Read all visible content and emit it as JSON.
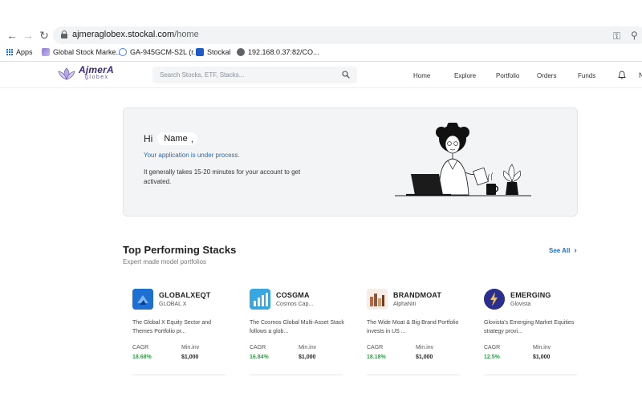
{
  "browser": {
    "url_host": "ajmeraglobex.stockal.com",
    "url_path": "/home",
    "bookmarks": [
      {
        "label": "Apps"
      },
      {
        "label": "Global Stock Marke..."
      },
      {
        "label": "GA-945GCM-S2L (r..."
      },
      {
        "label": "Stockal"
      },
      {
        "label": "192.168.0.37:82/CO..."
      }
    ]
  },
  "header": {
    "logo_name": "AjmerA",
    "logo_sub": "globex",
    "search_placeholder": "Search Stocks, ETF, Stacks...",
    "nav": [
      {
        "label": "Home"
      },
      {
        "label": "Explore"
      },
      {
        "label": "Portfolio"
      },
      {
        "label": "Orders"
      },
      {
        "label": "Funds"
      }
    ],
    "cut_text": "N"
  },
  "welcome": {
    "greeting": "Hi",
    "name": "Name",
    "comma": ",",
    "status": "Your application is under process.",
    "info": "It generally takes 15-20 minutes for your account to get activated."
  },
  "stacks": {
    "title": "Top Performing Stacks",
    "subtitle": "Expert made model portfolios",
    "see_all": "See All",
    "cagr_label": "CAGR",
    "min_label": "Min.inv",
    "items": [
      {
        "ticker": "GLOBALXEQT",
        "provider": "GLOBAL X",
        "desc": "The Global X Equity Sector and Themes Portfolio pr...",
        "cagr": "18.68%",
        "min_inv": "$1,000",
        "icon": "globalx-icon",
        "color": "#1d6fd1"
      },
      {
        "ticker": "COSGMA",
        "provider": "Cosmos Cap...",
        "desc": "The Cosmos Global Multi-Asset Stack follows a glob...",
        "cagr": "16.84%",
        "min_inv": "$1,000",
        "icon": "bar-chart-icon",
        "color": "#38a7e0"
      },
      {
        "ticker": "BRANDMOAT",
        "provider": "AlphaNiti",
        "desc": "The Wide Moat & Big Brand Portfolio invests in US ...",
        "cagr": "18.18%",
        "min_inv": "$1,000",
        "icon": "brandmoat-icon",
        "color": "#c9623b"
      },
      {
        "ticker": "EMERGING",
        "provider": "Glovista",
        "desc": "Glovista's Emerging Market Equities strategy provi...",
        "cagr": "12.5%",
        "min_inv": "$1,000",
        "icon": "lightning-icon",
        "color": "#2a2f8f"
      }
    ]
  },
  "colors": {
    "accent_blue": "#1f6fc5",
    "positive_green": "#2ea043",
    "card_bg": "#f3f4f6"
  }
}
